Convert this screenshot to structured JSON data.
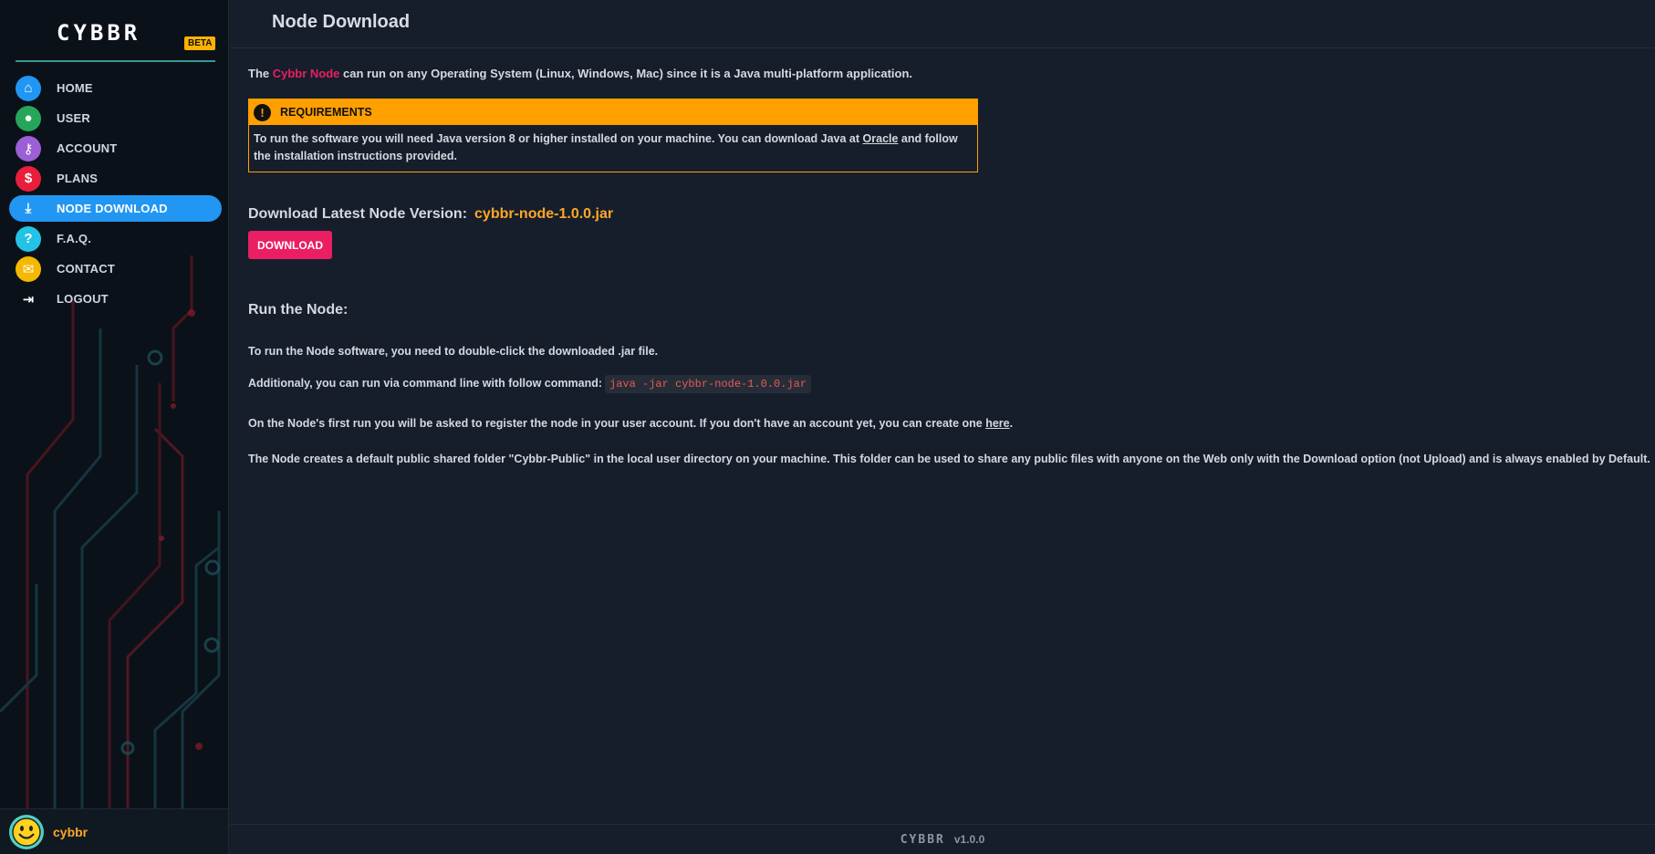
{
  "brand": {
    "logo": "CYBBR",
    "badge": "BETA"
  },
  "sidebar": {
    "items": [
      {
        "label": "HOME",
        "icon": "home-icon",
        "color": "#2196f3",
        "glyph": "⌂",
        "active": false
      },
      {
        "label": "USER",
        "icon": "user-icon",
        "color": "#26a65b",
        "glyph": "●",
        "active": false
      },
      {
        "label": "ACCOUNT",
        "icon": "key-icon",
        "color": "#9c5fd6",
        "glyph": "⚷",
        "active": false
      },
      {
        "label": "PLANS",
        "icon": "dollar-icon",
        "color": "#e91e3c",
        "glyph": "$",
        "active": false
      },
      {
        "label": "NODE DOWNLOAD",
        "icon": "download-icon",
        "color": "#2196f3",
        "glyph": "⤓",
        "active": true
      },
      {
        "label": "F.A.Q.",
        "icon": "question-icon",
        "color": "#22c3e6",
        "glyph": "?",
        "active": false
      },
      {
        "label": "CONTACT",
        "icon": "chat-icon",
        "color": "#f5b800",
        "glyph": "✉",
        "active": false
      },
      {
        "label": "LOGOUT",
        "icon": "logout-icon",
        "color": "transparent",
        "glyph": "⇥",
        "active": false
      }
    ]
  },
  "user": {
    "name": "cybbr"
  },
  "header": {
    "title": "Node Download"
  },
  "intro": {
    "prefix": "The ",
    "highlight": "Cybbr Node",
    "suffix": " can run on any Operating System (Linux, Windows, Mac) since it is a Java multi-platform application."
  },
  "requirements": {
    "title": "REQUIREMENTS",
    "text_before": "To run the software you will need Java version 8 or higher installed on your machine. You can download Java at ",
    "link": "Oracle",
    "text_after": " and follow the installation instructions provided."
  },
  "download": {
    "heading": "Download Latest Node Version:",
    "version": "cybbr-node-1.0.0.jar",
    "button": "DOWNLOAD"
  },
  "run": {
    "heading": "Run the Node:",
    "p1": "To run the Node software, you need to double-click the downloaded .jar file.",
    "p2": "Additionaly, you can run via command line with follow command:",
    "command": "java -jar cybbr-node-1.0.0.jar",
    "p3_before": "On the Node's first run you will be asked to register the node in your user account. If you don't have an account yet, you can create one ",
    "p3_link": "here",
    "p3_after": ".",
    "p4": "The Node creates a default public shared folder \"Cybbr-Public\" in the local user directory on your machine. This folder can be used to share any public files with anyone on the Web only with the Download option (not Upload) and is always enabled by Default."
  },
  "footer": {
    "logo": "CYBBR",
    "version": "v1.0.0"
  },
  "colors": {
    "accent": "#2196f3",
    "brand_pink": "#e91e63",
    "warning": "#ffa000",
    "version_orange": "#ffa726"
  }
}
